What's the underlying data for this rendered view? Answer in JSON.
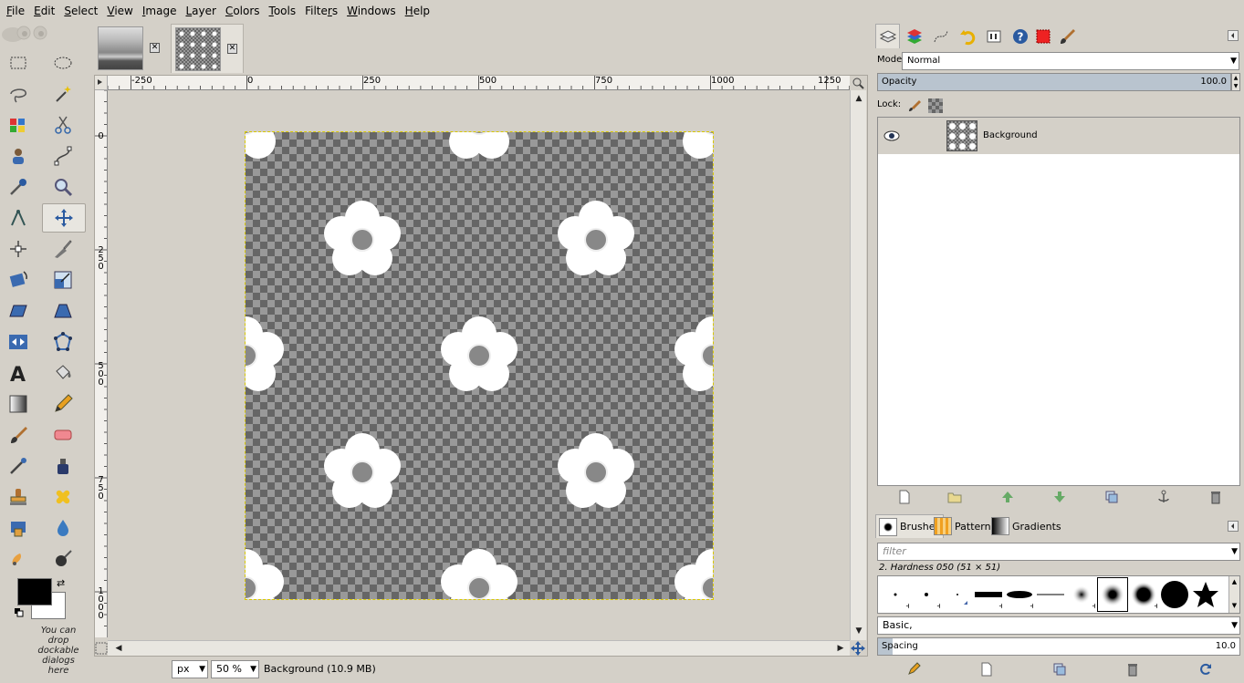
{
  "menu": [
    "File",
    "Edit",
    "Select",
    "View",
    "Image",
    "Layer",
    "Colors",
    "Tools",
    "Filters",
    "Windows",
    "Help"
  ],
  "menu_mnemonics": [
    "F",
    "E",
    "S",
    "V",
    "I",
    "L",
    "C",
    "T",
    "r",
    "W",
    "H"
  ],
  "toolbox": {
    "drop_hint": "You can drop dockable dialogs here",
    "fg_color": "#000000",
    "bg_color": "#ffffff"
  },
  "rulers": {
    "h_labels": [
      "-250",
      "0",
      "250",
      "500",
      "750",
      "1000",
      "1250"
    ],
    "v_labels": [
      "0",
      "250",
      "500",
      "750",
      "1000"
    ]
  },
  "statusbar": {
    "unit": "px",
    "zoom": "50 %",
    "status": "Background (10.9 MB)"
  },
  "layers": {
    "mode_label": "Mode:",
    "mode_value": "Normal",
    "opacity_label": "Opacity",
    "opacity_value": "100.0",
    "lock_label": "Lock:",
    "items": [
      {
        "name": "Background"
      }
    ]
  },
  "brushes": {
    "tabs": [
      "Brushes",
      "Patterns",
      "Gradients"
    ],
    "filter_placeholder": "filter",
    "selected_name": "2. Hardness 050 (51 × 51)",
    "preset": "Basic,",
    "spacing_label": "Spacing",
    "spacing_value": "10.0"
  },
  "colors": {
    "accent": "#b9c4cf",
    "panel": "#d4d0c8"
  }
}
